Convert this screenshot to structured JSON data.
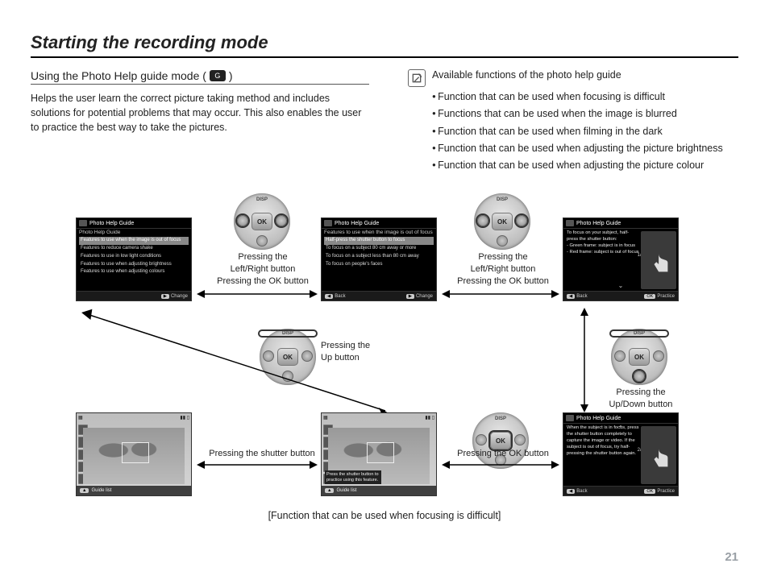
{
  "page": {
    "number": "21"
  },
  "title": "Starting the recording mode",
  "section": {
    "heading_pre": "Using the Photo Help guide mode (",
    "heading_post": ")",
    "icon_label": "G",
    "paragraph": "Helps the user learn the correct picture taking method and includes solutions for potential problems that may occur. This also enables the user to practice the best way to take the pictures."
  },
  "note": {
    "heading": "Available functions of the photo help guide",
    "items": [
      "Function that can be used when focusing is difficult",
      "Functions that can be used when the image is blurred",
      "Function that can be used when filming in the dark",
      "Function that can be used when adjusting the picture brightness",
      "Function that can be used when adjusting the picture colour"
    ]
  },
  "captions": {
    "lr_ok": "Pressing the\nLeft/Right button\nPressing the OK button",
    "up": "Pressing the\nUp button",
    "updown": "Pressing the\nUp/Down button",
    "shutter": "Pressing the shutter button",
    "ok": "Pressing the OK button",
    "bottom": "[Function that can be used when focusing is difficult]"
  },
  "screens": {
    "menu1": {
      "title": "Photo Help Guide",
      "sub": "Photo Help Guide",
      "items": [
        "Features to use when the image is out of focus",
        "Features to reduce camera shake",
        "Features to use in low light conditions",
        "Features to use when adjusting brightness",
        "Features to use when adjusting colours"
      ],
      "selected": 0,
      "foot_right_btn": "▶",
      "foot_right": "Change"
    },
    "menu2": {
      "title": "Photo Help Guide",
      "sub": "Features to use when the image is out of focus",
      "items": [
        "Half-press the shutter button to focus",
        "To focus on a subject 80 cm away or more",
        "To focus on a subject less than 80 cm away",
        "To focus on people's faces"
      ],
      "selected": 0,
      "foot_left_btn": "◀",
      "foot_left": "Back",
      "foot_right_btn": "▶",
      "foot_right": "Change"
    },
    "info1": {
      "title": "Photo Help Guide",
      "page": "1/2",
      "body": "To focus on your subject, half-press the shutter button:\n- Green frame: subject is in focus\n- Red frame: subject is out of focus",
      "foot_left_btn": "◀",
      "foot_left": "Back",
      "foot_right_btn": "OK",
      "foot_right": "Practice"
    },
    "info2": {
      "title": "Photo Help Guide",
      "page": "2/2",
      "body": "When the subject is in focus, press the shutter button completely to capture the image or video. If the subject is out of focus, try half-pressing the shutter button again.",
      "foot_left_btn": "◀",
      "foot_left": "Back",
      "foot_right_btn": "OK",
      "foot_right": "Practice"
    },
    "practice": {
      "tip": "Press the shutter button to practice using this feature.",
      "foot_btn": "▲",
      "foot": "Guide list"
    },
    "result": {
      "foot_btn": "▲",
      "foot": "Guide list"
    }
  },
  "dpad": {
    "ok": "OK",
    "disp": "DISP"
  }
}
